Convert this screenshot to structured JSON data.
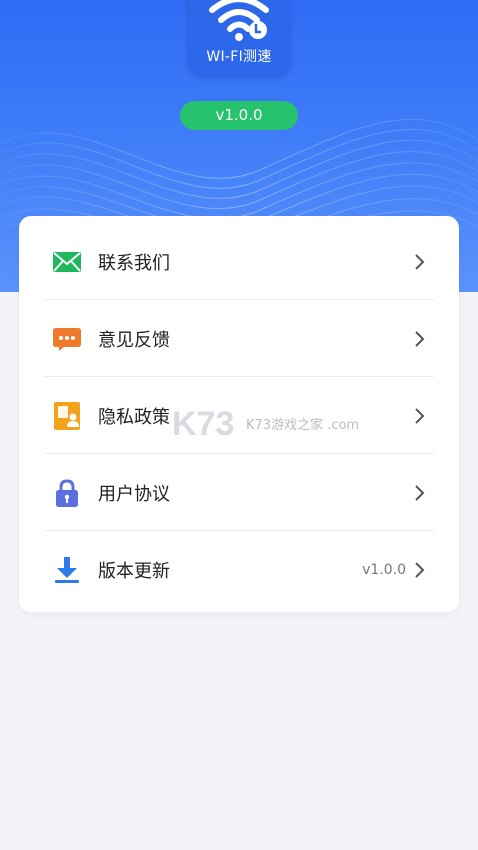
{
  "app": {
    "name": "WI-FI测速",
    "version": "v1.0.0",
    "icon": "wifi-icon"
  },
  "colors": {
    "header": "#3e7cf8",
    "pill": "#27c26d",
    "contact": "#1fb85c",
    "feedback": "#f07a2c",
    "privacy": "#f3a319",
    "agreement": "#5b6fe0",
    "update": "#2e7be8"
  },
  "menu": [
    {
      "label": "联系我们",
      "icon": "mail-icon",
      "value": ""
    },
    {
      "label": "意见反馈",
      "icon": "chat-bubble-icon",
      "value": ""
    },
    {
      "label": "隐私政策",
      "icon": "privacy-document-icon",
      "value": ""
    },
    {
      "label": "用户协议",
      "icon": "lock-icon",
      "value": ""
    },
    {
      "label": "版本更新",
      "icon": "download-icon",
      "value": "v1.0.0"
    }
  ],
  "watermark": {
    "text": "K73游戏之家 .com"
  }
}
